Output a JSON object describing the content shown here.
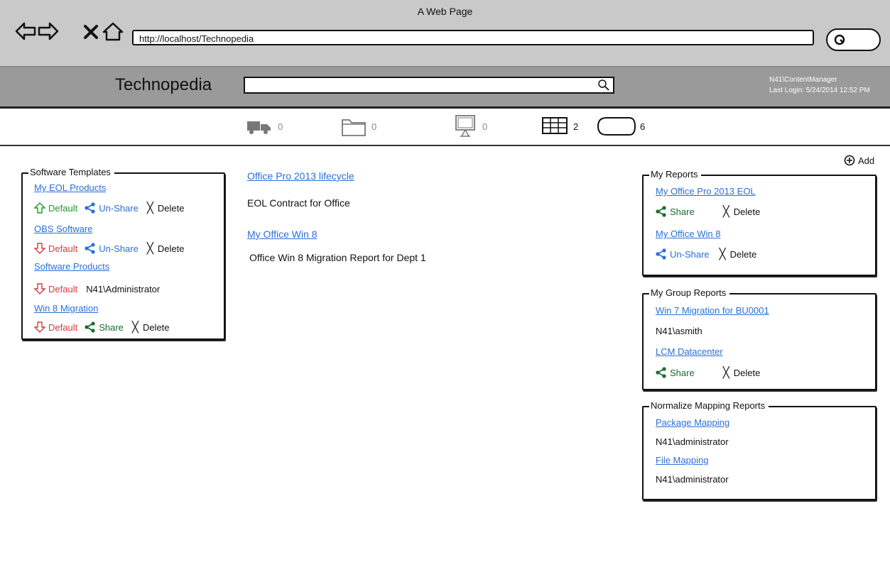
{
  "browser": {
    "window_title": "A Web Page",
    "url": "http://localhost/Technopedia"
  },
  "header": {
    "brand": "Technopedia",
    "search_placeholder": "",
    "user": "N41\\ContentManager",
    "last_login": "Last Login: 5/24/2014 12:52 PM"
  },
  "counters": [
    {
      "icon": "truck-icon",
      "count": "0"
    },
    {
      "icon": "folder-icon",
      "count": "0"
    },
    {
      "icon": "monitor-icon",
      "count": "0"
    },
    {
      "icon": "table-icon",
      "count": "2"
    },
    {
      "icon": "cloud-icon",
      "count": "6"
    }
  ],
  "software_templates": {
    "legend": "Software Templates",
    "items": [
      {
        "name": "My EOL Products",
        "default_label": "Default",
        "share_label": "Un-Share",
        "delete_label": "Delete"
      },
      {
        "name": "OBS Software",
        "default_label": "Default",
        "share_label": "Un-Share",
        "delete_label": "Delete"
      },
      {
        "name": "Software Products",
        "default_label": "Default",
        "owner": "N41\\Administrator"
      },
      {
        "name": "Win 8 Migration",
        "default_label": "Default",
        "share_label": "Share",
        "delete_label": "Delete"
      }
    ]
  },
  "center": {
    "items": [
      {
        "title": "Office Pro 2013 lifecycle",
        "description": "EOL Contract for Office"
      },
      {
        "title": "My Office Win 8",
        "description": "Office Win 8 Migration Report for Dept 1"
      }
    ]
  },
  "add_label": "Add",
  "my_reports": {
    "legend": "My Reports",
    "items": [
      {
        "name": "My Office Pro 2013 EOL",
        "share_label": "Share",
        "delete_label": "Delete"
      },
      {
        "name": "My Office Win 8",
        "share_label": "Un-Share",
        "delete_label": "Delete"
      }
    ]
  },
  "my_group_reports": {
    "legend": "My Group Reports",
    "items": [
      {
        "name": "Win 7 Migration for BU0001",
        "owner": "N41\\asmith"
      },
      {
        "name": "LCM Datacenter",
        "share_label": "Share",
        "delete_label": "Delete"
      }
    ]
  },
  "normalize_reports": {
    "legend": "Normalize Mapping Reports",
    "items": [
      {
        "name": "Package Mapping",
        "owner": "N41\\administrator"
      },
      {
        "name": "File Mapping",
        "owner": "N41\\administrator"
      }
    ]
  },
  "colors": {
    "link": "#2a6fd6",
    "default_up": "#1a9a2a",
    "default_down": "#d93a3a",
    "share": "#1a6a2a",
    "unshare": "#2a6fd6",
    "header_bg": "#9a9a9a",
    "chrome_bg": "#c9c9c9"
  }
}
